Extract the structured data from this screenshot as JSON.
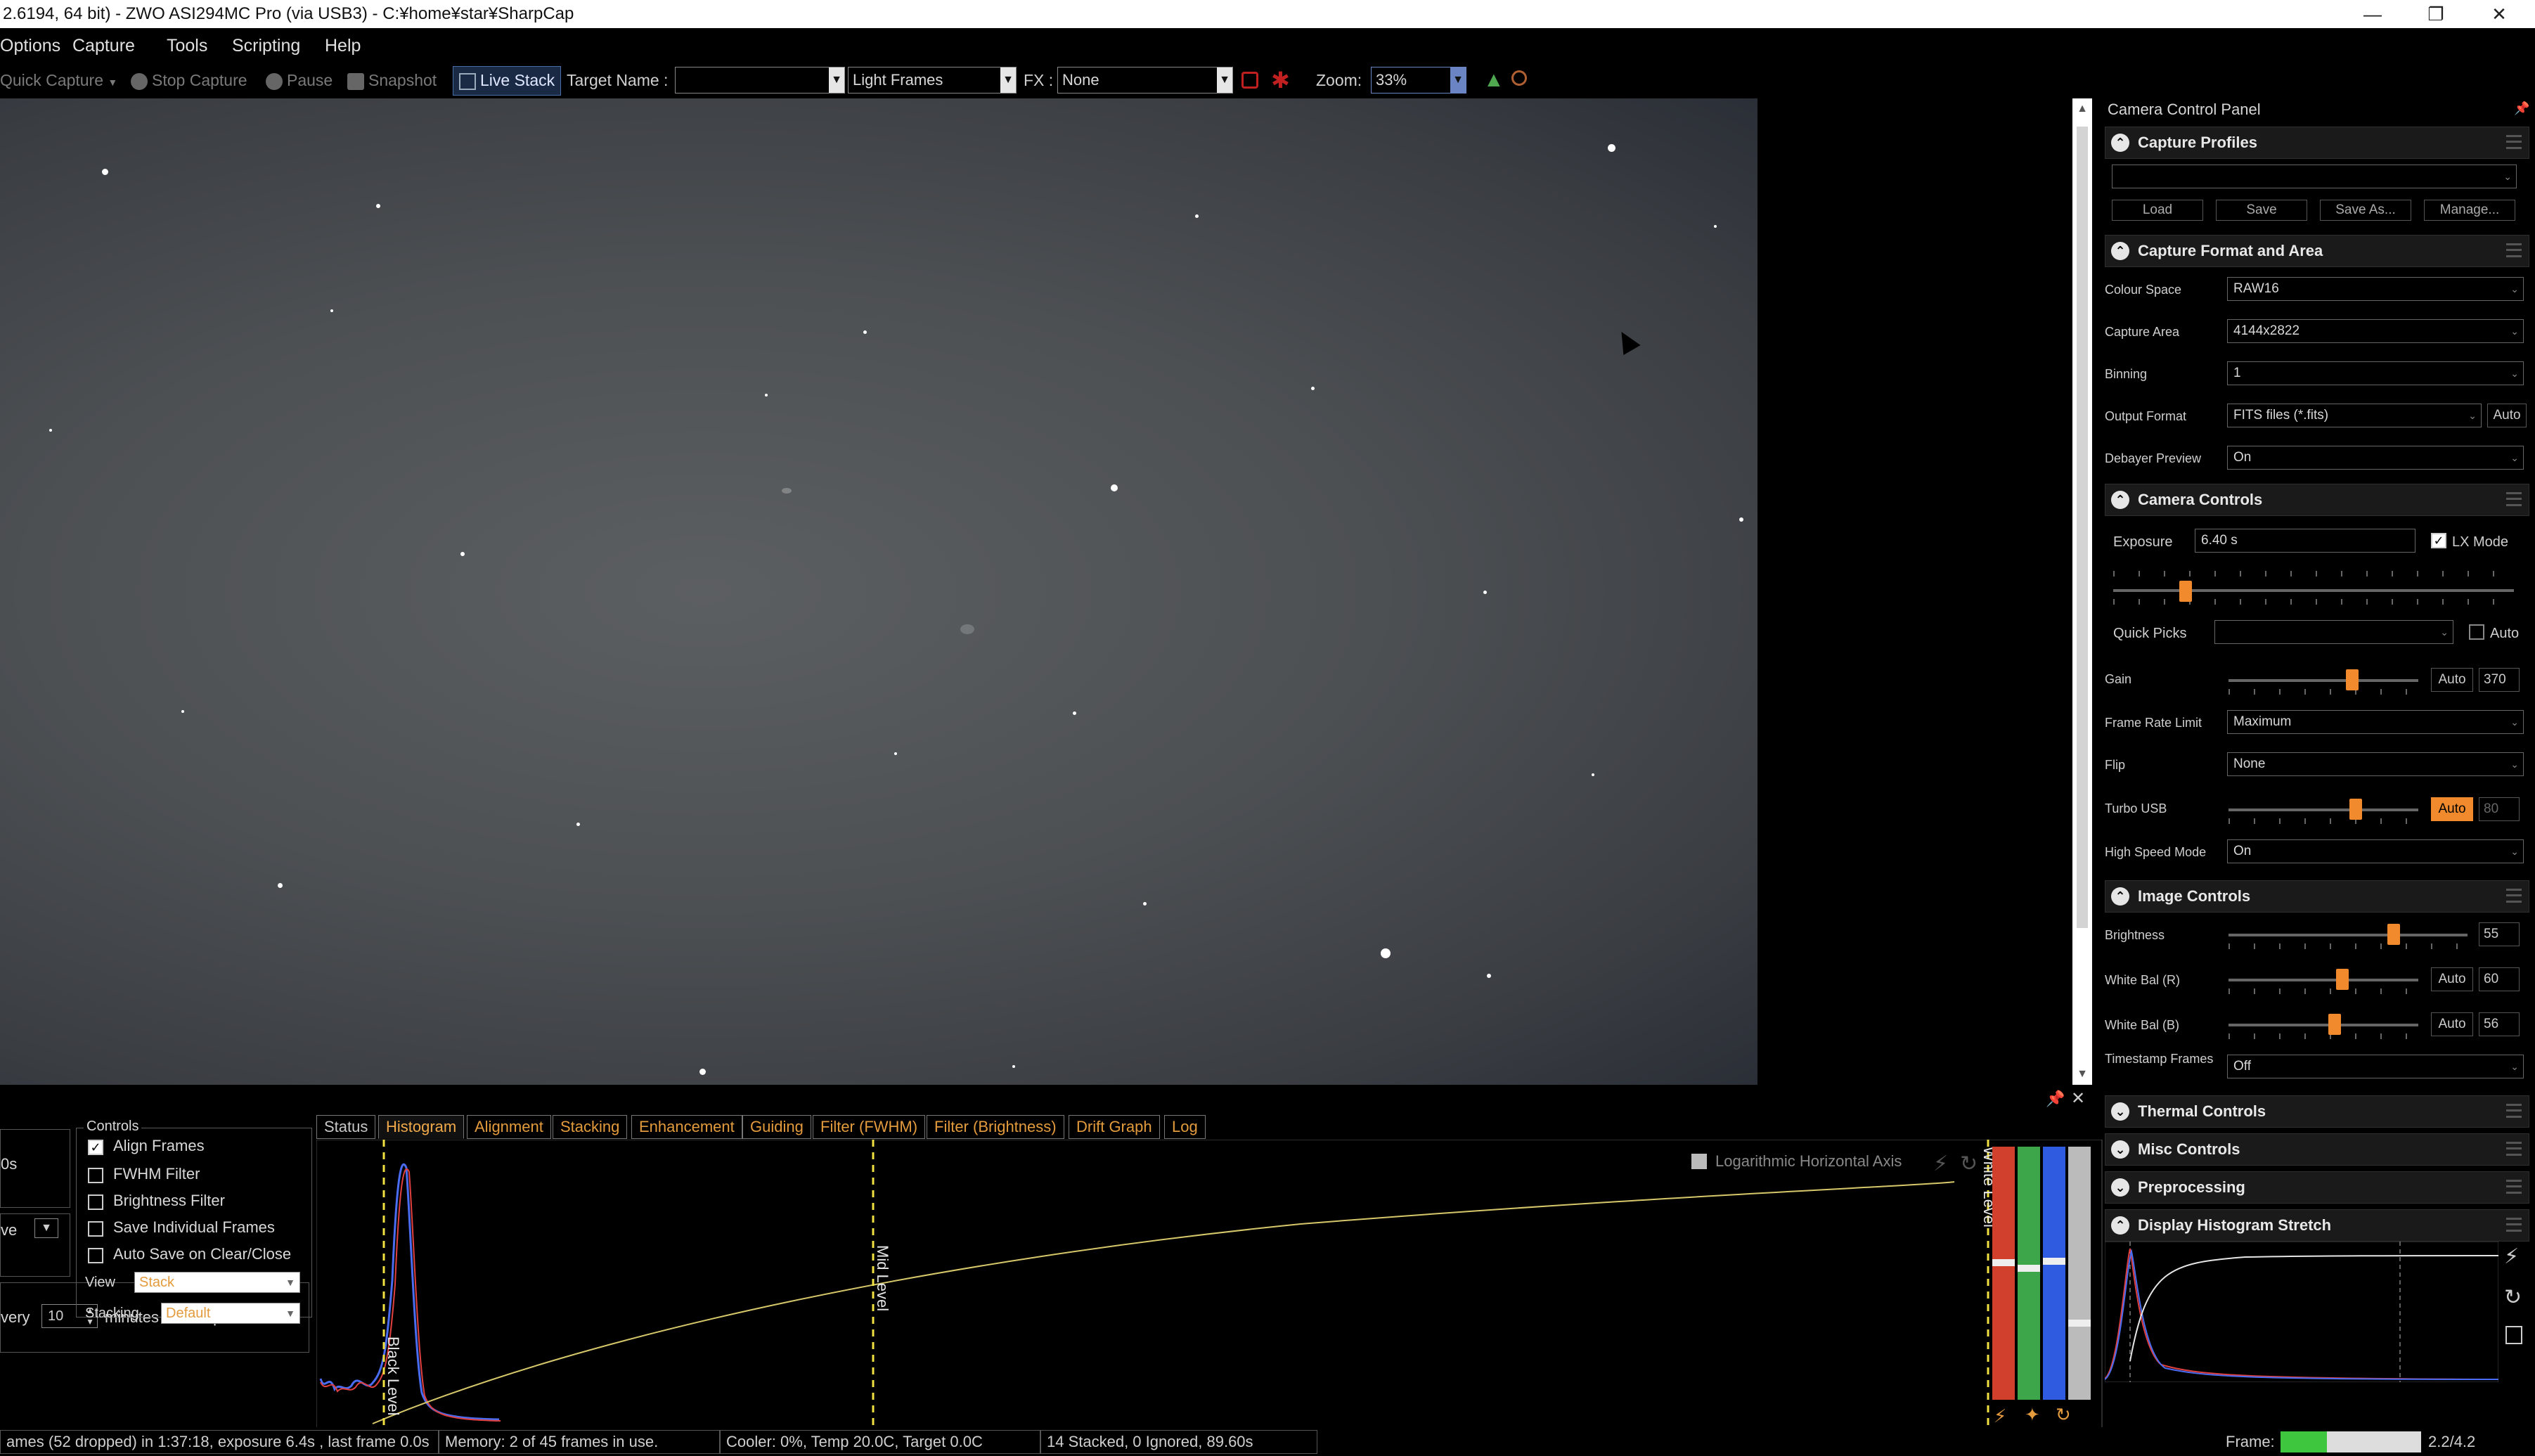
{
  "window": {
    "title": "2.6194, 64 bit) - ZWO ASI294MC Pro (via USB3) - C:¥home¥star¥SharpCap",
    "min": "—",
    "max": "❐",
    "close": "✕"
  },
  "menu": [
    "Options",
    "Capture",
    "Tools",
    "Scripting",
    "Help"
  ],
  "toolbar": {
    "quick_capture": "Quick Capture",
    "stop_capture": "Stop Capture",
    "pause": "Pause",
    "snapshot": "Snapshot",
    "live_stack": "Live Stack",
    "target_name_label": "Target Name :",
    "target_name_value": "",
    "frame_type": "Light Frames",
    "fx_label": "FX :",
    "fx_value": "None",
    "zoom_label": "Zoom:",
    "zoom_value": "33%"
  },
  "panel": {
    "title": "Camera Control Panel",
    "capture_profiles": {
      "title": "Capture Profiles",
      "profile": "",
      "load": "Load",
      "save": "Save",
      "save_as": "Save As...",
      "manage": "Manage..."
    },
    "capture_format": {
      "title": "Capture Format and Area",
      "colour_space_label": "Colour Space",
      "colour_space": "RAW16",
      "capture_area_label": "Capture Area",
      "capture_area": "4144x2822",
      "binning_label": "Binning",
      "binning": "1",
      "output_format_label": "Output Format",
      "output_format": "FITS files (*.fits)",
      "auto": "Auto",
      "debayer_label": "Debayer Preview",
      "debayer": "On"
    },
    "camera_controls": {
      "title": "Camera Controls",
      "exposure_label": "Exposure",
      "exposure": "6.40 s",
      "lx_mode": "LX Mode",
      "exposure_level": 0.18,
      "quick_picks_label": "Quick Picks",
      "quick_picks": "",
      "auto": "Auto",
      "gain_label": "Gain",
      "gain_auto": "Auto",
      "gain": "370",
      "gain_level": 0.65,
      "frame_rate_label": "Frame Rate Limit",
      "frame_rate": "Maximum",
      "flip_label": "Flip",
      "flip": "None",
      "turbo_label": "Turbo USB",
      "turbo_auto": "Auto",
      "turbo": "80",
      "turbo_level": 0.67,
      "hsm_label": "High Speed Mode",
      "hsm": "On"
    },
    "image_controls": {
      "title": "Image Controls",
      "brightness_label": "Brightness",
      "brightness": "55",
      "brightness_level": 0.69,
      "wbr_label": "White Bal (R)",
      "wbr_auto": "Auto",
      "wbr": "60",
      "wbr_level": 0.6,
      "wbb_label": "White Bal (B)",
      "wbb_auto": "Auto",
      "wbb": "56",
      "wbb_level": 0.56,
      "ts_label": "Timestamp Frames",
      "ts": "Off"
    },
    "thermal": "Thermal Controls",
    "misc": "Misc Controls",
    "preprocessing": "Preprocessing",
    "display_stretch": "Display Histogram Stretch"
  },
  "bottom": {
    "tabs": [
      "Status",
      "Histogram",
      "Alignment",
      "Stacking",
      "Enhancement",
      "Guiding",
      "Filter (FWHM)",
      "Filter (Brightness)",
      "Drift Graph",
      "Log"
    ],
    "controls_title": "Controls",
    "align_frames": "Align Frames",
    "fwhm_filter": "FWHM Filter",
    "brightness_filter": "Brightness Filter",
    "save_individual": "Save Individual Frames",
    "auto_save": "Auto Save on Clear/Close",
    "view_label": "View",
    "view_value": "Stack",
    "stacking_label": "Stacking",
    "stacking_value": "Default",
    "left_partial_1": "0s",
    "left_partial_2": "ve",
    "every_label": "very",
    "every_value": "10",
    "minutes_label": "minutes total exposure",
    "log_axis": "Logarithmic Horizontal Axis",
    "black_level": "Black Level",
    "mid_level": "Mid Level",
    "white_level": "White Level"
  },
  "status": {
    "frames": "ames (52 dropped) in 1:37:18, exposure 6.4s , last frame 0.0s",
    "memory": "Memory: 2 of 45 frames in use.",
    "cooler": "Cooler: 0%, Temp 20.0C, Target 0.0C",
    "stacked": "14 Stacked, 0 Ignored, 89.60s",
    "frame_label": "Frame:",
    "frame_value": "2.2/4.2"
  }
}
